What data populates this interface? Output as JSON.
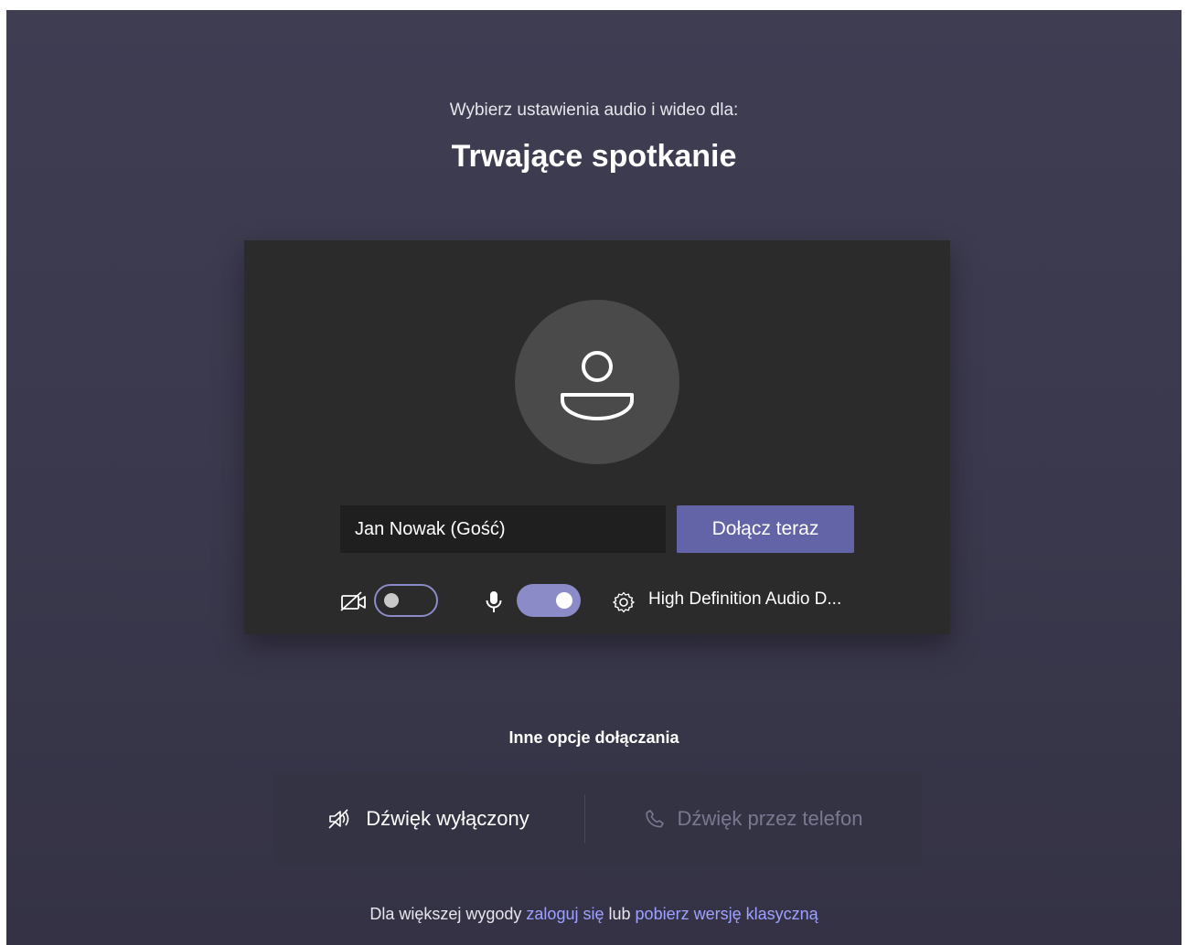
{
  "header": {
    "subtitle": "Wybierz ustawienia audio i wideo dla:",
    "title": "Trwające spotkanie"
  },
  "card": {
    "name_value": "Jan Nowak (Gość)",
    "join_label": "Dołącz teraz",
    "camera_enabled": false,
    "mic_enabled": true,
    "device_label": "High Definition Audio D..."
  },
  "other_options": {
    "label": "Inne opcje dołączania",
    "audio_off_label": "Dźwięk wyłączony",
    "phone_audio_label": "Dźwięk przez telefon"
  },
  "footer": {
    "prefix": "Dla większej wygody",
    "sign_in_link": "zaloguj się",
    "middle": "lub",
    "download_link": "pobierz wersję klasyczną"
  },
  "colors": {
    "accent": "#6264a7",
    "toggle_accent": "#8b8cc7",
    "link": "#9ea2ff"
  },
  "icons": {
    "avatar": "person-icon",
    "camera": "video-off-icon",
    "mic": "microphone-icon",
    "settings": "gear-icon",
    "audio_off": "speaker-off-icon",
    "phone": "phone-icon"
  }
}
